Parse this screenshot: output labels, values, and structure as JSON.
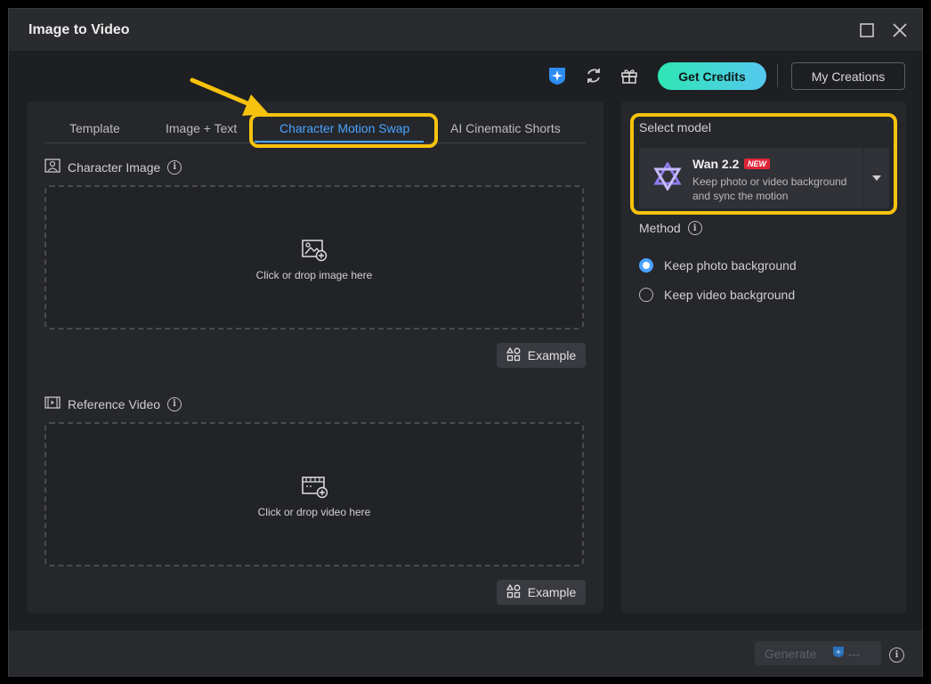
{
  "window": {
    "title": "Image to Video"
  },
  "toolbar": {
    "credits_label": "Get Credits",
    "my_creations_label": "My Creations"
  },
  "tabs": [
    {
      "label": "Template"
    },
    {
      "label": "Image + Text"
    },
    {
      "label": "Character Motion Swap"
    },
    {
      "label": "AI Cinematic Shorts"
    }
  ],
  "character_image": {
    "label": "Character Image",
    "drop_text": "Click or drop image here",
    "example_label": "Example"
  },
  "reference_video": {
    "label": "Reference Video",
    "drop_text": "Click or drop video here",
    "example_label": "Example"
  },
  "model": {
    "select_label": "Select model",
    "name": "Wan 2.2",
    "badge": "NEW",
    "description": "Keep photo or video background and sync the motion"
  },
  "method": {
    "label": "Method",
    "options": [
      {
        "label": "Keep photo background",
        "selected": true
      },
      {
        "label": "Keep video background",
        "selected": false
      }
    ]
  },
  "footer": {
    "generate_label": "Generate",
    "cost": "---"
  },
  "colors": {
    "accent": "#4aa3ff",
    "highlight": "#f6c20d",
    "credits_gradient_start": "#2ee6b5",
    "credits_gradient_end": "#56c8ef"
  }
}
